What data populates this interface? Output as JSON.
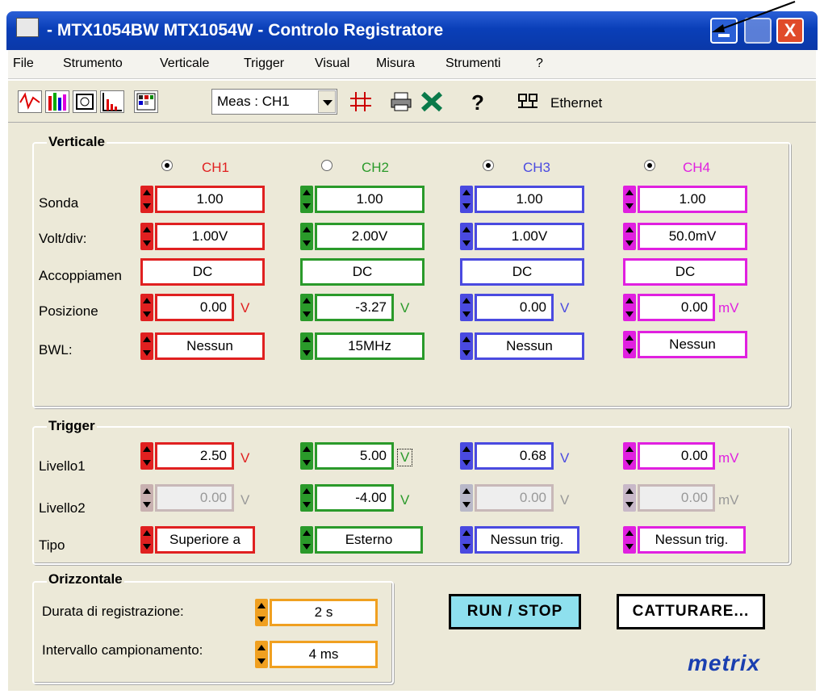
{
  "window": {
    "title": "- MTX1054BW MTX1054W - Controlo Registratore",
    "close_glyph": "X"
  },
  "menu": [
    "File",
    "Strumento",
    "Verticale",
    "Trigger",
    "Visual",
    "Misura",
    "Strumenti",
    "?"
  ],
  "toolbar": {
    "meas_select": "Meas : CH1",
    "ethernet_label": "Ethernet"
  },
  "vertical": {
    "title": "Verticale",
    "row_labels": [
      "Sonda",
      "Volt/div:",
      "Accoppiamen",
      "Posizione",
      "BWL:"
    ],
    "channels": [
      {
        "name": "CH1",
        "color": "#e02020",
        "selected": true,
        "sonda": "1.00",
        "volt_div": "1.00V",
        "coupling": "DC",
        "position": "0.00",
        "pos_unit": "V",
        "bwl": "Nessun"
      },
      {
        "name": "CH2",
        "color": "#2a9a2a",
        "selected": false,
        "sonda": "1.00",
        "volt_div": "2.00V",
        "coupling": "DC",
        "position": "-3.27",
        "pos_unit": "V",
        "bwl": "15MHz"
      },
      {
        "name": "CH3",
        "color": "#4a4ae0",
        "selected": true,
        "sonda": "1.00",
        "volt_div": "1.00V",
        "coupling": "DC",
        "position": "0.00",
        "pos_unit": "V",
        "bwl": "Nessun"
      },
      {
        "name": "CH4",
        "color": "#e020e0",
        "selected": true,
        "sonda": "1.00",
        "volt_div": "50.0mV",
        "coupling": "DC",
        "position": "0.00",
        "pos_unit": "mV",
        "bwl": "Nessun"
      }
    ]
  },
  "trigger": {
    "title": "Trigger",
    "row_labels": [
      "Livello1",
      "Livello2",
      "Tipo"
    ],
    "channels": [
      {
        "level1": "2.50",
        "l1_unit": "V",
        "level2": "0.00",
        "l2_unit": "V",
        "type": "Superiore a"
      },
      {
        "level1": "5.00",
        "l1_unit": "V",
        "level2": "-4.00",
        "l2_unit": "V",
        "type": "Esterno"
      },
      {
        "level1": "0.68",
        "l1_unit": "V",
        "level2": "0.00",
        "l2_unit": "V",
        "type": "Nessun trig."
      },
      {
        "level1": "0.00",
        "l1_unit": "mV",
        "level2": "0.00",
        "l2_unit": "mV",
        "type": "Nessun trig."
      }
    ]
  },
  "horizontal": {
    "title": "Orizzontale",
    "duration_label": "Durata di registrazione:",
    "duration_value": "2 s",
    "interval_label": "Intervallo campionamento:",
    "interval_value": "4 ms"
  },
  "buttons": {
    "run_stop": "RUN / STOP",
    "capture": "CATTURARE..."
  },
  "logo": "metrix"
}
